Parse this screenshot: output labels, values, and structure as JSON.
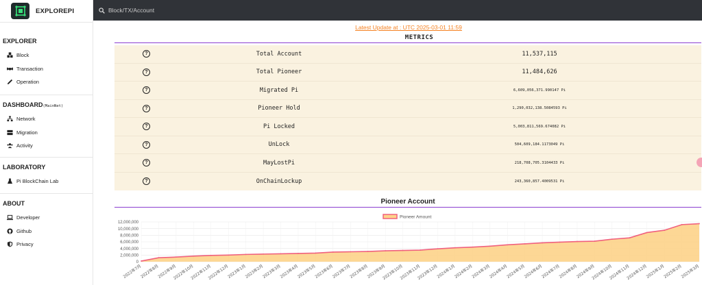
{
  "brand": {
    "name": "EXPLOREPI"
  },
  "search": {
    "placeholder": "Block/TX/Account"
  },
  "sidebar": {
    "explorer": {
      "title": "EXPLORER",
      "items": [
        {
          "label": "Block",
          "icon": "cubes-icon"
        },
        {
          "label": "Transaction",
          "icon": "handshake-icon"
        },
        {
          "label": "Operation",
          "icon": "pencil-icon"
        }
      ]
    },
    "dashboard": {
      "title": "DASHBOARD",
      "tag": "(MainNet)",
      "items": [
        {
          "label": "Network",
          "icon": "network-icon"
        },
        {
          "label": "Migration",
          "icon": "server-icon"
        },
        {
          "label": "Activity",
          "icon": "users-icon"
        }
      ]
    },
    "laboratory": {
      "title": "LABORATORY",
      "items": [
        {
          "label": "Pi BlockChain Lab",
          "icon": "flask-icon"
        }
      ]
    },
    "about": {
      "title": "ABOUT",
      "items": [
        {
          "label": "Developer",
          "icon": "laptop-icon"
        },
        {
          "label": "Github",
          "icon": "github-icon"
        },
        {
          "label": "Privacy",
          "icon": "shield-icon"
        }
      ]
    }
  },
  "update_text": "Latest Update at : UTC 2025-03-01 11:59",
  "metrics": {
    "title": "METRICS",
    "rows": [
      {
        "label": "Total Account",
        "value": "11,537,115",
        "size": "big"
      },
      {
        "label": "Total Pioneer",
        "value": "11,484,626",
        "size": "big"
      },
      {
        "label": "Migrated Pi",
        "value": "6,609,056,371.990147 Pi",
        "size": "small"
      },
      {
        "label": "Pioneer Hold",
        "value": "1,290,032,138.5084593 Pi",
        "size": "small"
      },
      {
        "label": "Pi Locked",
        "value": "5,003,811,569.674082 Pi",
        "size": "small"
      },
      {
        "label": "UnLock",
        "value": "504,609,184.1173049 Pi",
        "size": "small"
      },
      {
        "label": "MayLostPi",
        "value": "218,708,705.3104433 Pi",
        "size": "small"
      },
      {
        "label": "OnChainLockup",
        "value": "243,360,857.4009531 Pi",
        "size": "small"
      }
    ]
  },
  "colors": {
    "accent_orange": "#f5801f",
    "purple_rule": "#8a3ccf",
    "metrics_bg": "#faf2e0",
    "line": "#f0607e",
    "area": "#fdd38a"
  },
  "chart_title": "Pioneer Account",
  "chart_data": {
    "type": "area",
    "legend": "Pioneer Amount",
    "legend_position": "top-center",
    "ylim": [
      0,
      12000000
    ],
    "yticks": [
      "0",
      "2,000,000",
      "4,000,000",
      "6,000,000",
      "8,000,000",
      "10,000,000",
      "12,000,000"
    ],
    "grid": true,
    "categories": [
      "2022年7月",
      "2022年8月",
      "2022年9月",
      "2022年10月",
      "2022年11月",
      "2022年12月",
      "2023年1月",
      "2023年2月",
      "2023年3月",
      "2023年4月",
      "2023年5月",
      "2023年6月",
      "2023年7月",
      "2023年8月",
      "2023年9月",
      "2023年10月",
      "2023年11月",
      "2023年12月",
      "2024年1月",
      "2024年2月",
      "2024年3月",
      "2024年4月",
      "2024年5月",
      "2024年6月",
      "2024年7月",
      "2024年8月",
      "2024年9月",
      "2024年10月",
      "2024年11月",
      "2024年12月",
      "2025年1月",
      "2025年2月",
      "2025年3月"
    ],
    "values": [
      200000,
      1200000,
      1400000,
      1700000,
      1900000,
      2000000,
      2200000,
      2300000,
      2400000,
      2500000,
      2600000,
      2900000,
      3000000,
      3100000,
      3300000,
      3400000,
      3500000,
      3900000,
      4200000,
      4400000,
      4700000,
      5100000,
      5400000,
      5700000,
      5900000,
      6100000,
      6200000,
      6800000,
      7200000,
      8800000,
      9500000,
      11200000,
      11484626
    ]
  }
}
